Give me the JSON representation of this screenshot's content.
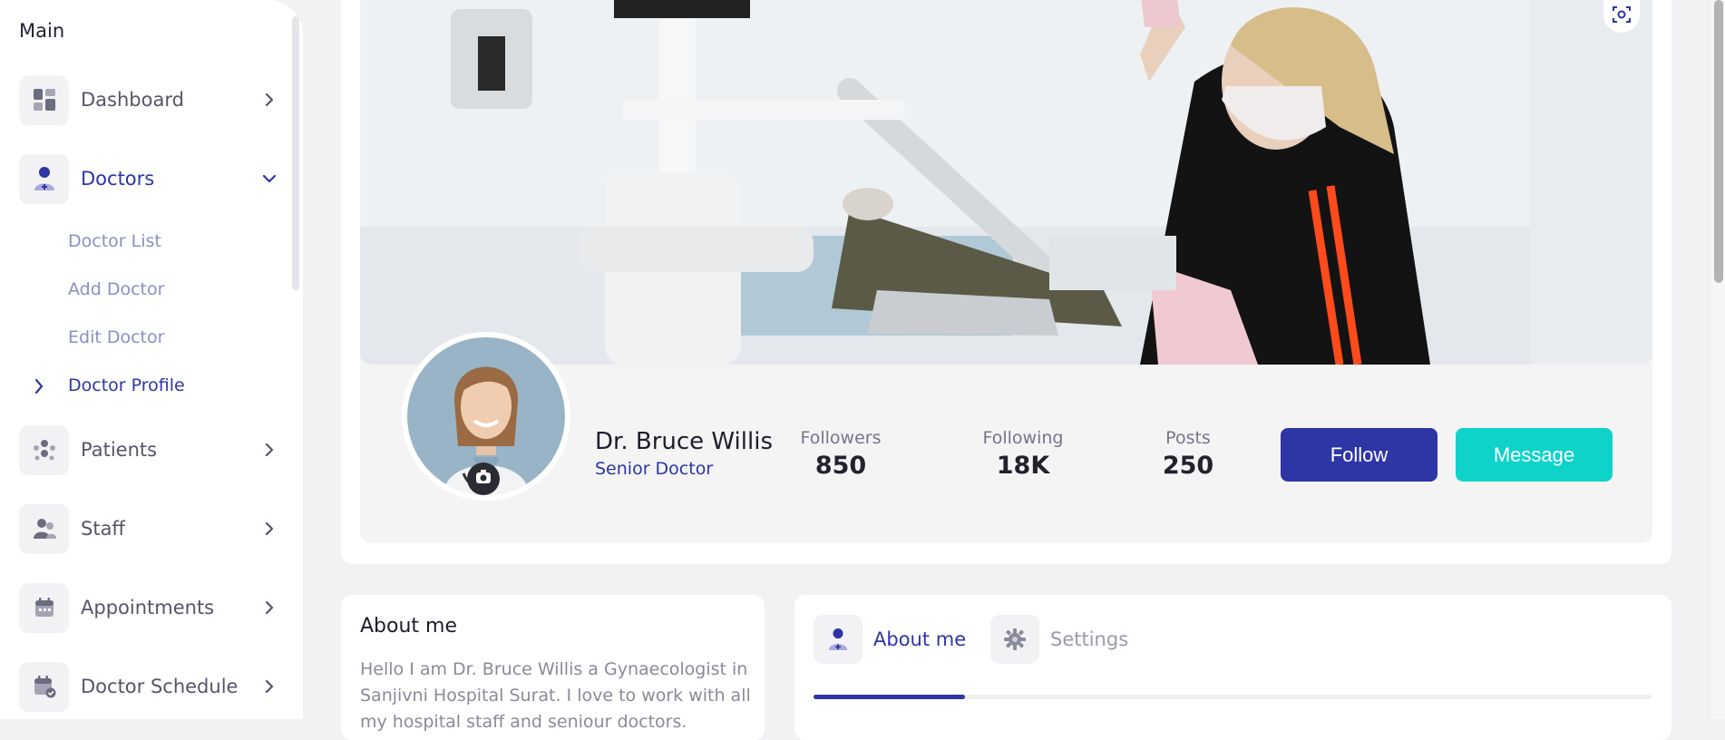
{
  "sidebar": {
    "section_title": "Main",
    "items": [
      {
        "label": "Dashboard",
        "icon": "dashboard-icon"
      },
      {
        "label": "Doctors",
        "icon": "doctor-icon",
        "expanded": true
      },
      {
        "label": "Patients",
        "icon": "patients-icon"
      },
      {
        "label": "Staff",
        "icon": "staff-icon"
      },
      {
        "label": "Appointments",
        "icon": "calendar-icon"
      },
      {
        "label": "Doctor Schedule",
        "icon": "schedule-icon"
      }
    ],
    "doctor_submenu": [
      "Doctor List",
      "Add Doctor",
      "Edit Doctor",
      "Doctor Profile"
    ]
  },
  "profile": {
    "name": "Dr. Bruce Willis",
    "role": "Senior Doctor",
    "stats": [
      {
        "label": "Followers",
        "value": "850"
      },
      {
        "label": "Following",
        "value": "18K"
      },
      {
        "label": "Posts",
        "value": "250"
      }
    ],
    "follow_label": "Follow",
    "message_label": "Message"
  },
  "about": {
    "title": "About me",
    "text": "Hello I am Dr. Bruce Willis a Gynaecologist in Sanjivni Hospital Surat. I love to work with all my hospital staff and seniour doctors."
  },
  "tabs": [
    {
      "label": "About me",
      "icon": "doctor-icon",
      "active": true
    },
    {
      "label": "Settings",
      "icon": "gear-icon",
      "active": false
    }
  ],
  "colors": {
    "primary": "#2e35a4",
    "accent": "#0fd3c9",
    "submenu": "#8b8fc4",
    "muted": "#55556a"
  }
}
